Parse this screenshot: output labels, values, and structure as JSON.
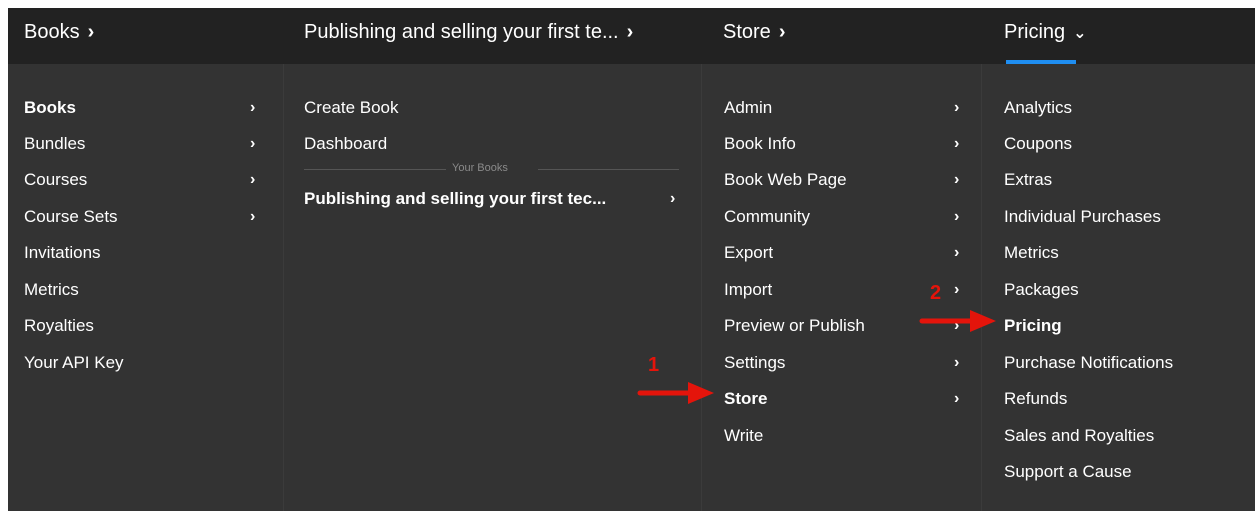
{
  "topbar": {
    "crumbs": [
      {
        "label": "Books"
      },
      {
        "label": "Publishing and selling your first te..."
      },
      {
        "label": "Store"
      },
      {
        "label": "Pricing"
      }
    ]
  },
  "menu_books": {
    "items": [
      "Books",
      "Bundles",
      "Courses",
      "Course Sets",
      "Invitations",
      "Metrics",
      "Royalties",
      "Your API Key"
    ]
  },
  "menu_book_list": {
    "items": [
      "Create Book",
      "Dashboard"
    ],
    "section_label": "Your Books",
    "book_title": "Publishing and selling your first tec..."
  },
  "menu_book_sections": {
    "items": [
      "Admin",
      "Book Info",
      "Book Web Page",
      "Community",
      "Export",
      "Import",
      "Preview or Publish",
      "Settings",
      "Store",
      "Write"
    ]
  },
  "menu_store": {
    "items": [
      "Analytics",
      "Coupons",
      "Extras",
      "Individual Purchases",
      "Metrics",
      "Packages",
      "Pricing",
      "Purchase Notifications",
      "Refunds",
      "Sales and Royalties",
      "Support a Cause"
    ]
  },
  "annotations": {
    "step1": "1",
    "step2": "2"
  },
  "colors": {
    "accent": "#1f8ef1",
    "annotation": "#e4140b",
    "panel": "#333333",
    "topbar": "#222222"
  }
}
